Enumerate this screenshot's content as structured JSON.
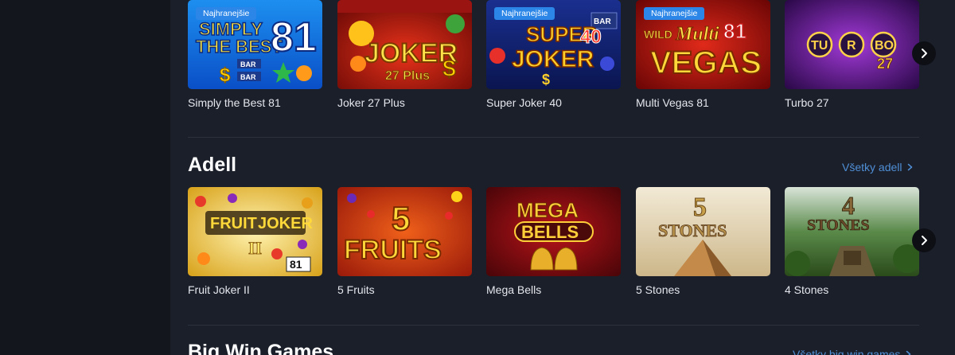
{
  "sections": {
    "top": {
      "tiles": [
        {
          "name": "Simply the Best 81",
          "badge": "Najhranejšie"
        },
        {
          "name": "Joker 27 Plus",
          "badge": ""
        },
        {
          "name": "Super Joker 40",
          "badge": "Najhranejšie"
        },
        {
          "name": "Multi Vegas 81",
          "badge": "Najhranejšie"
        },
        {
          "name": "Turbo 27",
          "badge": ""
        }
      ]
    },
    "adell": {
      "title": "Adell",
      "link": "Všetky adell",
      "tiles": [
        {
          "name": "Fruit Joker II"
        },
        {
          "name": "5 Fruits"
        },
        {
          "name": "Mega Bells"
        },
        {
          "name": "5 Stones"
        },
        {
          "name": "4 Stones"
        }
      ]
    },
    "bigwin": {
      "title": "Big Win Games",
      "link": "Všetky big win games"
    }
  },
  "art": {
    "t1": {
      "l1": "SIMPLY",
      "l2": "THE BEST",
      "num": "81",
      "bar1": "BAR",
      "bar2": "BAR"
    },
    "t2": {
      "l1": "JOKER",
      "l2": "27 Plus"
    },
    "t3": {
      "l1": "SUPER",
      "l2": "JOKER",
      "num": "40",
      "bar": "BAR"
    },
    "t4": {
      "l1": "WILD",
      "l2": "Multi",
      "l3": "VEGAS",
      "num": "81"
    },
    "t5": {
      "l1": "TU",
      "l2": "R",
      "l3": "BO",
      "num": "27"
    },
    "a1": {
      "l1": "FRUIT",
      "l2": "JOKER",
      "l3": "II",
      "num": "81"
    },
    "a2": {
      "l1": "5",
      "l2": "FRUITS"
    },
    "a3": {
      "l1": "MEGA",
      "l2": "BELLS"
    },
    "a4": {
      "l1": "5",
      "l2": "STONES"
    },
    "a5": {
      "l1": "4",
      "l2": "STONES"
    }
  },
  "colors": {
    "accent": "#2b86e8",
    "link": "#4f8fd6",
    "panel": "#1b1f2a"
  },
  "icons": {
    "next": "chevron-right-icon"
  }
}
